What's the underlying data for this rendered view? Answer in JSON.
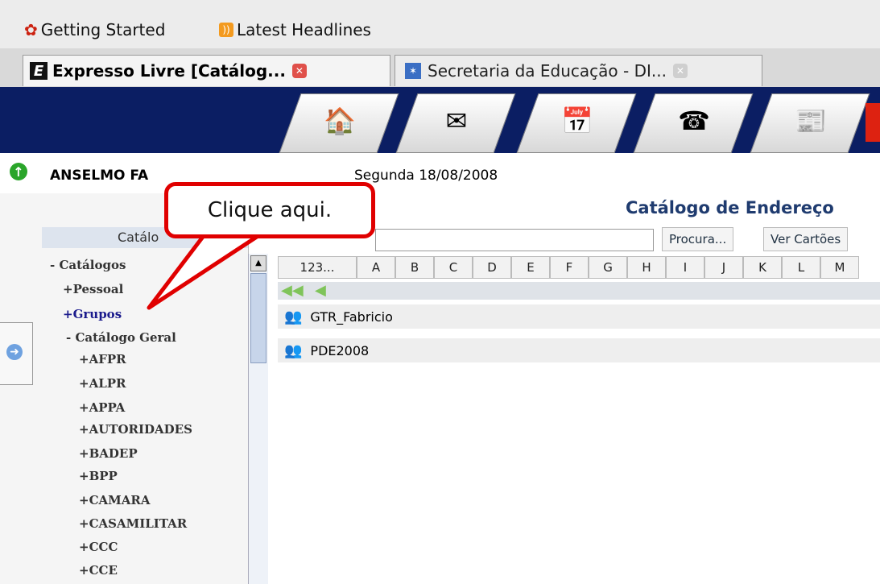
{
  "bookmarks": {
    "getting_started": "Getting Started",
    "latest_headlines": "Latest Headlines"
  },
  "tabs": [
    {
      "label": "Expresso Livre [Catálog...",
      "icon": "letter-e-icon"
    },
    {
      "label": "Secretaria da Educação - DI...",
      "icon": "site-icon"
    }
  ],
  "infobar": {
    "user": "ANSELMO FA",
    "date": "Segunda 18/08/2008"
  },
  "panel": {
    "title": "Catálogo de Endereço",
    "left_header": "Catálo",
    "search_button": "Procura...",
    "cards_button": "Ver Cartões"
  },
  "tree": {
    "root": "Catálogos",
    "pessoal": "Pessoal",
    "grupos": "Grupos",
    "geral": "Catálogo Geral",
    "children": [
      "AFPR",
      "ALPR",
      "APPA",
      "AUTORIDADES",
      "BADEP",
      "BPP",
      "CAMARA",
      "CASAMILITAR",
      "CCC",
      "CCE"
    ]
  },
  "letters": [
    "123...",
    "A",
    "B",
    "C",
    "D",
    "E",
    "F",
    "G",
    "H",
    "I",
    "J",
    "K",
    "L",
    "M"
  ],
  "groups": [
    "GTR_Fabricio",
    "PDE2008"
  ],
  "callout": "Clique aqui.",
  "colors": {
    "navbar": "#0b1e63",
    "callout_border": "#e00000",
    "link": "#1a1a8c"
  }
}
